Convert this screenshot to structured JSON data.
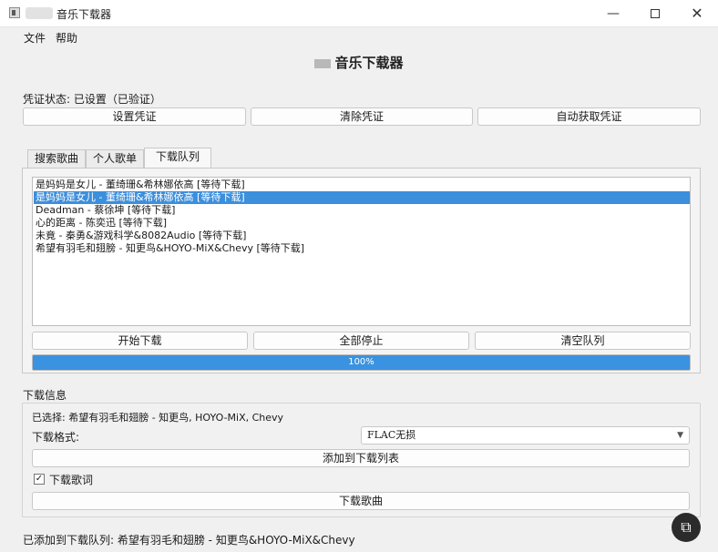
{
  "window": {
    "title": "音乐下载器",
    "controls": {
      "minimize": "—",
      "maximize": "",
      "close": "✕"
    }
  },
  "menu": {
    "file": "文件",
    "help": "帮助"
  },
  "heading": "音乐下载器",
  "credentials": {
    "status": "凭证状态: 已设置（已验证）",
    "set_button": "设置凭证",
    "clear_button": "清除凭证",
    "auto_button": "自动获取凭证"
  },
  "tabs": [
    {
      "label": "搜索歌曲"
    },
    {
      "label": "个人歌单"
    },
    {
      "label": "下载队列"
    }
  ],
  "queue": {
    "items": [
      "是妈妈是女儿 - 董绮珊&希林娜依高 [等待下载]",
      "是妈妈是女儿 - 董绮珊&希林娜依高 [等待下载]",
      "Deadman - 蔡徐坤 [等待下载]",
      "心的距离 - 陈奕迅 [等待下载]",
      "未竟 - 秦勇&游戏科学&8082Audio [等待下载]",
      "希望有羽毛和翅膀 - 知更鸟&HOYO-MiX&Chevy [等待下载]"
    ],
    "selected_index": 1,
    "start_button": "开始下载",
    "stop_button": "全部停止",
    "clear_button": "清空队列",
    "progress_percent": 100,
    "progress_text": "100%"
  },
  "download_info": {
    "title": "下载信息",
    "selected": "已选择: 希望有羽毛和翅膀 - 知更鸟, HOYO-MiX, Chevy",
    "format_label": "下载格式:",
    "format_value": "FLAC无损",
    "add_button": "添加到下载列表",
    "lyrics_checked": true,
    "lyrics_check_mark": "✓",
    "lyrics_label": "下载歌词",
    "download_button": "下载歌曲"
  },
  "status_bar": "已添加到下载队列: 希望有羽毛和翅膀 - 知更鸟&HOYO-MiX&Chevy",
  "icons": {
    "app": "app-icon",
    "snip": "snip-icon",
    "dropdown": "chevron-down-icon"
  },
  "colors": {
    "selection": "#3c8fdc",
    "progress": "#3a92e0"
  }
}
